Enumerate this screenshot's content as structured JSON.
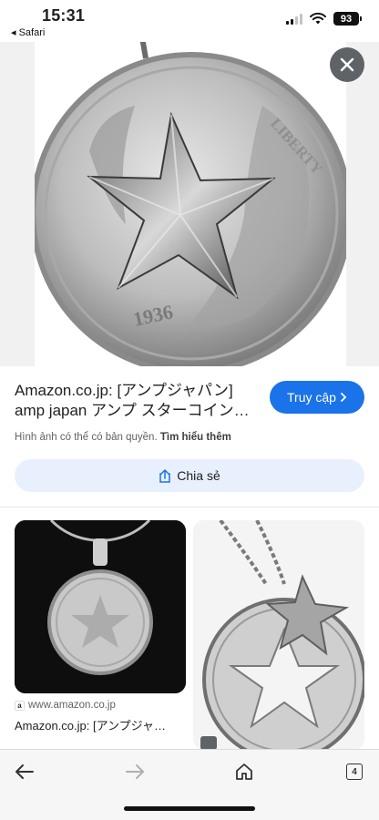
{
  "status_bar": {
    "time": "15:31",
    "back_app": "◂ Safari",
    "battery": "93"
  },
  "hero": {
    "image_icon": "coin-star-pendant-image",
    "close_icon": "close-icon",
    "coin_text": "LIBERTY",
    "coin_year": "1936"
  },
  "info": {
    "title": "Amazon.co.jp: [アンプジャパン] amp japan アンプ スターコイン…",
    "visit_label": "Truy cập",
    "copyright_text": "Hình ảnh có thể có bản quyền.",
    "learn_more": "Tìm hiểu thêm",
    "share_label": "Chia sẻ"
  },
  "results": [
    {
      "domain": "www.amazon.co.jp",
      "title": "Amazon.co.jp: [アンプジャ…"
    }
  ],
  "toolbar": {
    "tab_count": "4"
  },
  "colors": {
    "accent": "#1a73e8",
    "share_bg": "#e8f0fe",
    "close_bg": "#5f6368"
  }
}
